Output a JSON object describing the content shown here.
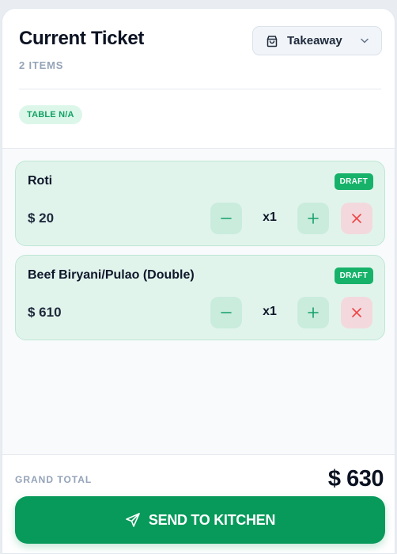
{
  "ticket": {
    "title": "Current Ticket",
    "item_count": "2 ITEMS",
    "table_chip": "TABLE N/A"
  },
  "order_type": {
    "selected": "Takeaway",
    "icon": "shopping-bag-icon"
  },
  "items": [
    {
      "name": "Roti",
      "status": "DRAFT",
      "price": "$ 20",
      "qty": "x1"
    },
    {
      "name": "Beef Biryani/Pulao (Double)",
      "status": "DRAFT",
      "price": "$ 610",
      "qty": "x1"
    }
  ],
  "footer": {
    "grand_total_label": "GRAND TOTAL",
    "grand_total_value": "$ 630",
    "send_label": "SEND TO KITCHEN",
    "send_icon": "send-icon"
  },
  "colors": {
    "accent": "#079a5b",
    "draft_badge": "#17b26a",
    "card_bg": "#e1f4ec",
    "delete": "#ef4444"
  }
}
